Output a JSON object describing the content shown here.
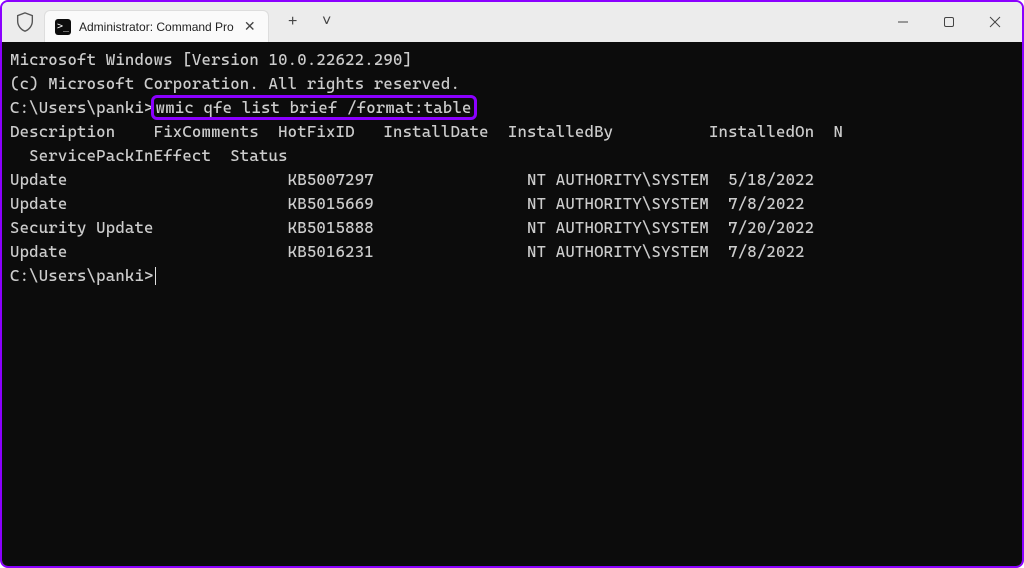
{
  "titlebar": {
    "tab_title": "Administrator: Command Pro",
    "shield_name": "shield-icon",
    "cmd_icon_glyph": ">_",
    "plus": "+",
    "chevron": "˅"
  },
  "terminal": {
    "banner_line1": "Microsoft Windows [Version 10.0.22622.290]",
    "banner_line2": "(c) Microsoft Corporation. All rights reserved.",
    "prompt_path": "C:\\Users\\panki>",
    "command": "wmic qfe list brief /format:table",
    "header_line": "Description    FixComments  HotFixID   InstallDate  InstalledBy          InstalledOn  N",
    "header_line2": "  ServicePackInEffect  Status",
    "rows": [
      {
        "desc": "Update",
        "hotfix": "KB5007297",
        "by": "NT AUTHORITY\\SYSTEM",
        "on": "5/18/2022"
      },
      {
        "desc": "Update",
        "hotfix": "KB5015669",
        "by": "NT AUTHORITY\\SYSTEM",
        "on": "7/8/2022"
      },
      {
        "desc": "Security Update",
        "hotfix": "KB5015888",
        "by": "NT AUTHORITY\\SYSTEM",
        "on": "7/20/2022"
      },
      {
        "desc": "Update",
        "hotfix": "KB5016231",
        "by": "NT AUTHORITY\\SYSTEM",
        "on": "7/8/2022"
      }
    ],
    "final_prompt": "C:\\Users\\panki>"
  }
}
